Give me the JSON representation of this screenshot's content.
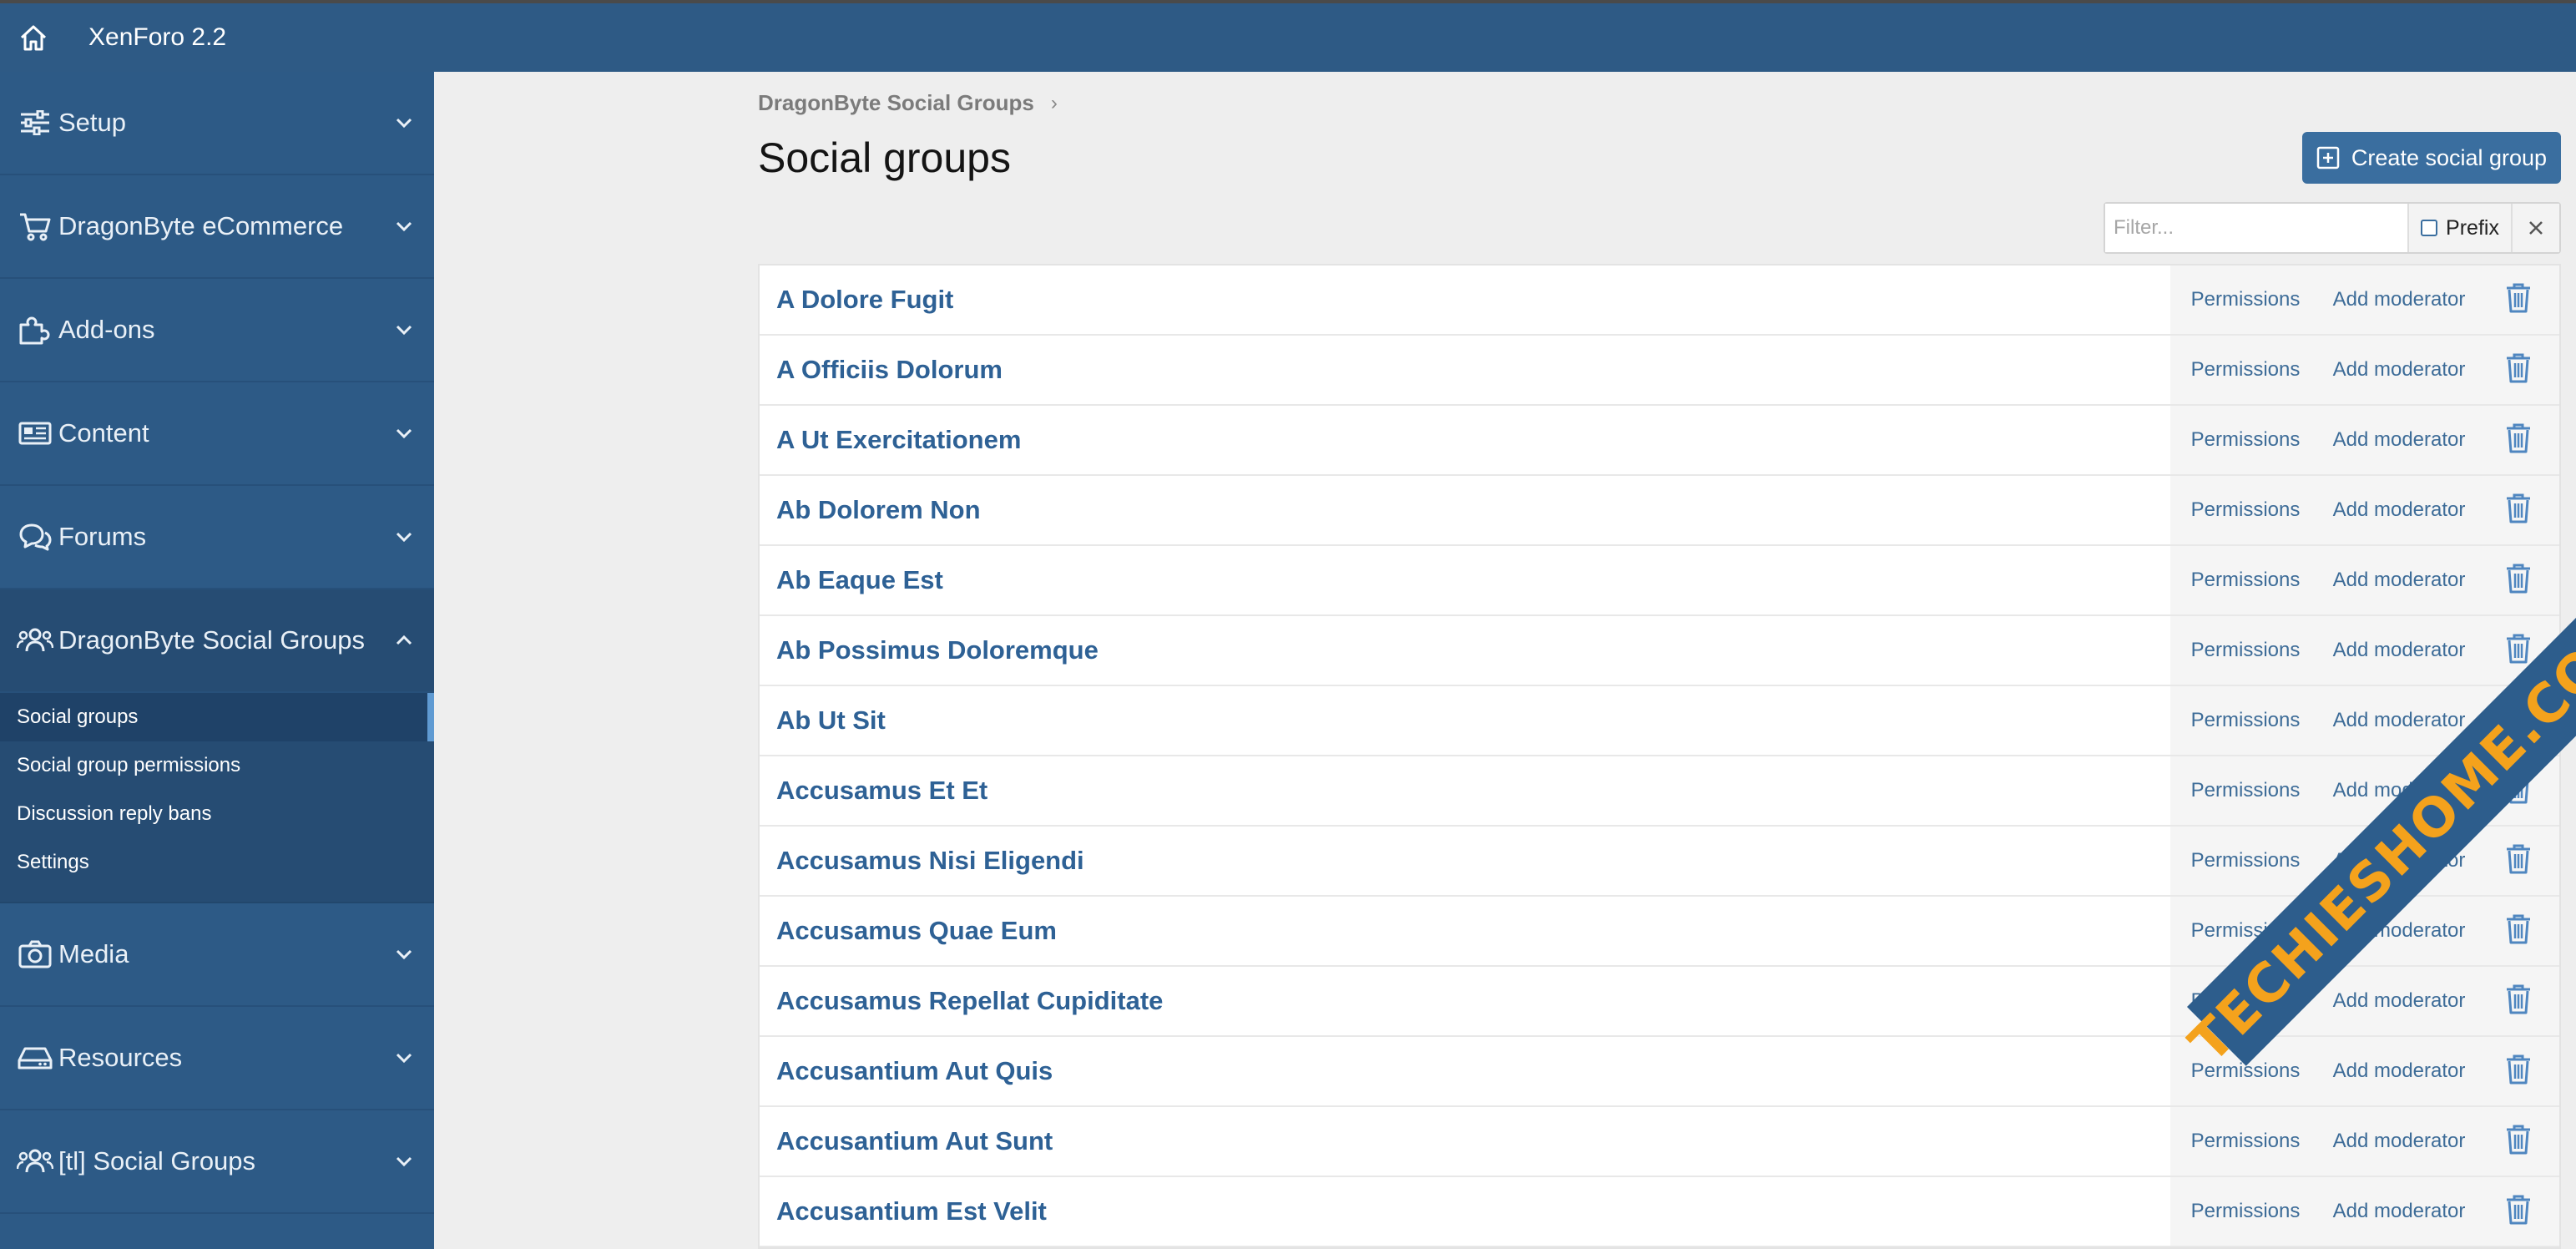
{
  "header": {
    "title": "XenForo 2.2"
  },
  "sidebar": {
    "sections": [
      {
        "label": "Setup",
        "icon": "sliders-icon"
      },
      {
        "label": "DragonByte eCommerce",
        "icon": "cart-icon"
      },
      {
        "label": "Add-ons",
        "icon": "puzzle-icon"
      },
      {
        "label": "Content",
        "icon": "newspaper-icon"
      },
      {
        "label": "Forums",
        "icon": "comments-icon"
      },
      {
        "label": "DragonByte Social Groups",
        "icon": "users-icon",
        "expanded": true
      },
      {
        "label": "Media",
        "icon": "camera-icon"
      },
      {
        "label": "Resources",
        "icon": "hdd-icon"
      },
      {
        "label": "[tl] Social Groups",
        "icon": "users-icon"
      }
    ],
    "subitems": [
      {
        "label": "Social groups",
        "active": true
      },
      {
        "label": "Social group permissions"
      },
      {
        "label": "Discussion reply bans"
      },
      {
        "label": "Settings"
      }
    ]
  },
  "breadcrumb": {
    "item": "DragonByte Social Groups"
  },
  "page": {
    "title": "Social groups",
    "create_label": "Create social group"
  },
  "filter": {
    "placeholder": "Filter...",
    "prefix_label": "Prefix"
  },
  "row_actions": {
    "permissions": "Permissions",
    "add_moderator": "Add moderator"
  },
  "groups": [
    "A Dolore Fugit",
    "A Officiis Dolorum",
    "A Ut Exercitationem",
    "Ab Dolorem Non",
    "Ab Eaque Est",
    "Ab Possimus Doloremque",
    "Ab Ut Sit",
    "Accusamus Et Et",
    "Accusamus Nisi Eligendi",
    "Accusamus Quae Eum",
    "Accusamus Repellat Cupiditate",
    "Accusantium Aut Quis",
    "Accusantium Aut Sunt",
    "Accusantium Est Velit"
  ],
  "watermark": {
    "text": "TECHIESHOME.COM"
  },
  "colors": {
    "header": "#2e5a85",
    "sidebar": "#2d5a86",
    "link": "#2e6195",
    "button": "#3a6e9f",
    "watermark_text": "#f4a21c"
  }
}
